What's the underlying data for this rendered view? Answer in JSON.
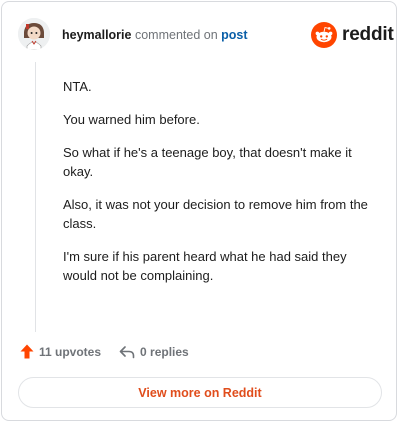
{
  "comment": {
    "username": "heymallorie",
    "action_text": "commented on",
    "post_link": "post",
    "paragraphs": [
      "NTA.",
      "You warned him before.",
      "So what if he's a teenage boy, that doesn't make it okay.",
      "Also, it was not your decision to remove him from the class.",
      "I'm sure if his parent heard what he had said they would not be complaining."
    ]
  },
  "brand": {
    "wordmark": "reddit",
    "icon": "reddit-alien-icon",
    "color": "#ff4500"
  },
  "actions": {
    "upvotes_label": "11 upvotes",
    "replies_label": "0 replies",
    "upvote_icon": "upvote-arrow-icon",
    "reply_icon": "reply-arrow-icon",
    "upvote_color": "#ff4500"
  },
  "footer": {
    "view_more_label": "View more on Reddit",
    "accent": "#e04d1c"
  }
}
